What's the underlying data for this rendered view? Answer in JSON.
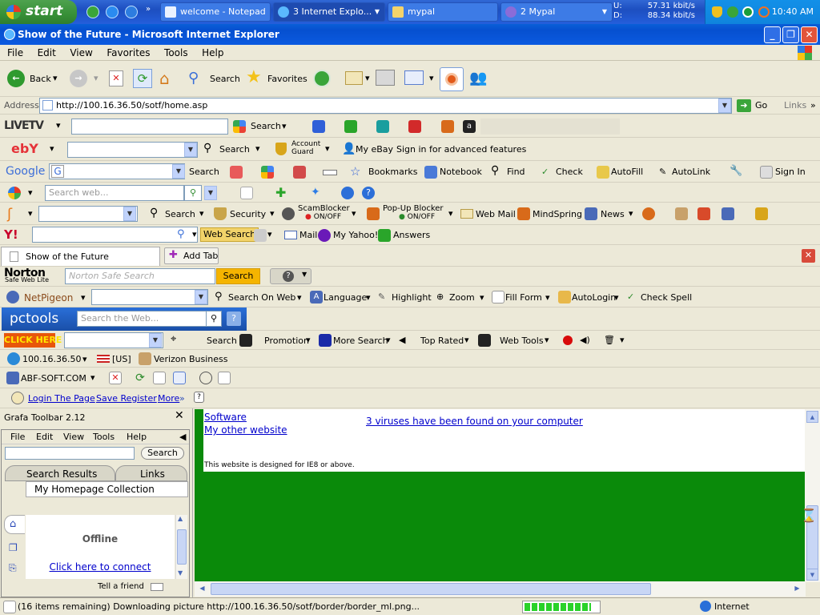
{
  "taskbar": {
    "start_label": "start",
    "buttons": [
      {
        "label": "welcome - Notepad"
      },
      {
        "label": "3 Internet Explo..."
      },
      {
        "label": "mypal"
      },
      {
        "label": "2 Mypal"
      }
    ],
    "net_upload": "57.31 kbit/s",
    "net_download": "88.34 kbit/s",
    "net_up_prefix": "U:",
    "net_down_prefix": "D:",
    "clock": "10:40 AM"
  },
  "window": {
    "title": "Show of the Future - Microsoft Internet Explorer",
    "menu": [
      "File",
      "Edit",
      "View",
      "Favorites",
      "Tools",
      "Help"
    ]
  },
  "toolbar": {
    "back": "Back",
    "search": "Search",
    "favorites": "Favorites"
  },
  "address": {
    "label": "Address",
    "url": "http://100.16.36.50/sotf/home.asp",
    "go": "Go",
    "links": "Links"
  },
  "livetv": {
    "logo": "LIVETV",
    "search": "Search"
  },
  "ebay": {
    "logo": "ebY",
    "search": "Search",
    "account_guard": "Account Guard",
    "my_ebay": "My eBay",
    "sign_in": "Sign in for advanced features"
  },
  "google": {
    "logo": "Google",
    "search": "Search",
    "bookmarks": "Bookmarks",
    "notebook": "Notebook",
    "find": "Find",
    "check": "Check",
    "autofill": "AutoFill",
    "autolink": "AutoLink",
    "sign_in": "Sign In"
  },
  "msn": {
    "placeholder": "Search web..."
  },
  "toolbar5": {
    "search": "Search",
    "security": "Security",
    "scamblocker": "ScamBlocker",
    "scam_state": "ON/OFF",
    "popup": "Pop-Up Blocker",
    "popup_state": "ON/OFF",
    "webmail": "Web Mail",
    "mindspring": "MindSpring",
    "news": "News"
  },
  "yahoo": {
    "logo": "Y!",
    "web_search": "Web Search",
    "mail": "Mail",
    "my_yahoo": "My Yahoo!",
    "answers": "Answers"
  },
  "tabs": {
    "current": "Show of the Future",
    "add": "Add Tab"
  },
  "norton": {
    "logo": "Norton",
    "sub": "Safe Web Lite",
    "placeholder": "Norton Safe Search",
    "search": "Search"
  },
  "netpigeon": {
    "logo": "NetPigeon",
    "search_on_web": "Search On Web",
    "language": "Language",
    "highlight": "Highlight",
    "zoom": "Zoom",
    "fill_form": "Fill Form",
    "autologin": "AutoLogin",
    "check_spell": "Check Spell"
  },
  "pctools": {
    "logo": "pctools",
    "placeholder": "Search the Web..."
  },
  "clickhere": {
    "logo": "CLICK HERE",
    "search": "Search",
    "promotion": "Promotion",
    "more_search": "More Search",
    "top_rated": "Top Rated",
    "web_tools": "Web Tools"
  },
  "ipbar": {
    "ip": "100.16.36.50",
    "country": "[US]",
    "isp": "Verizon Business"
  },
  "abf": {
    "label": "ABF-SOFT.COM"
  },
  "loginbar": {
    "login": "Login The Page",
    "save": "Save Register",
    "more": "More"
  },
  "grafa": {
    "title": "Grafa Toolbar 2.12",
    "menu": [
      "File",
      "Edit",
      "View",
      "Tools",
      "Help"
    ],
    "search": "Search",
    "tab_results": "Search Results",
    "tab_links": "Links",
    "collection": "My Homepage Collection",
    "offline": "Offline",
    "connect": "Click here to connect",
    "tell_friend": "Tell a friend"
  },
  "page": {
    "link_software": "Software",
    "link_other": "My other website",
    "virus_link": "3 viruses have been found on your computer",
    "note": "This website is designed for IE8 or above."
  },
  "status": {
    "text": "(16 items remaining) Downloading picture http://100.16.36.50/sotf/border/border_ml.png...",
    "zone": "Internet",
    "progress": 0.9
  },
  "colors": {
    "content_green": "#0a8a0a",
    "link": "#0000cc",
    "xp_blue": "#0a5fd8"
  }
}
